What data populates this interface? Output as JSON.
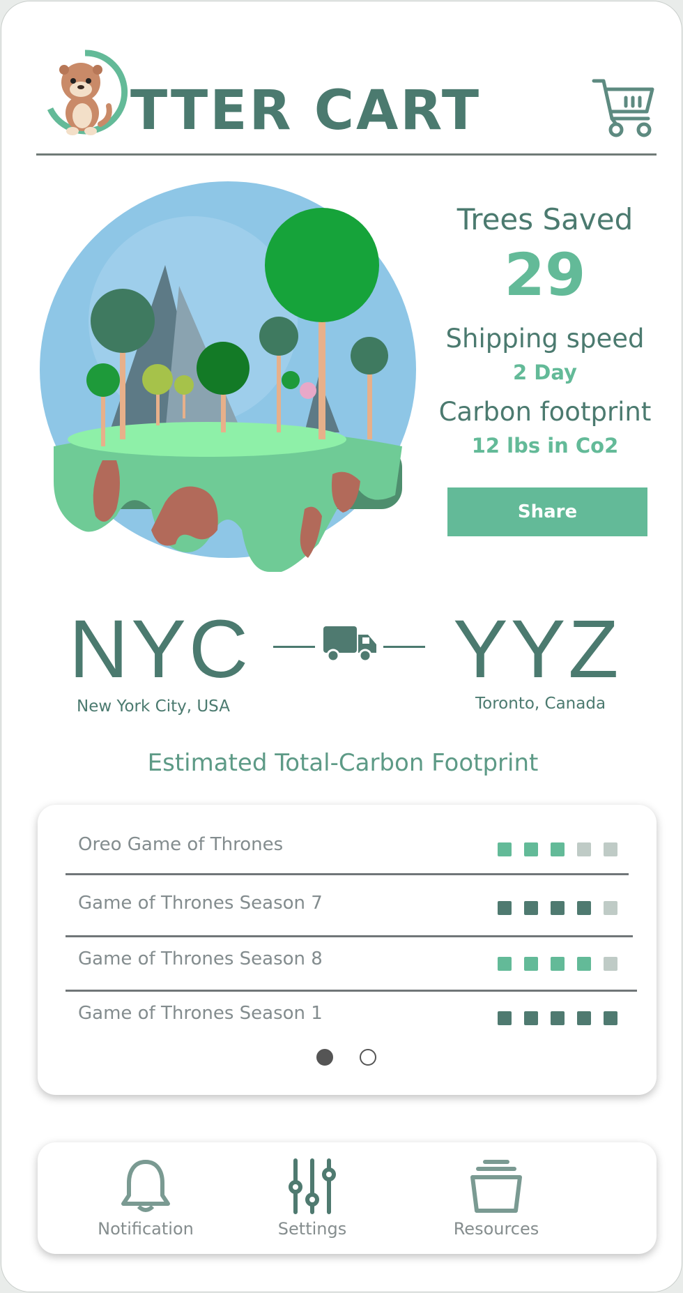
{
  "header": {
    "brand": "TTER CART",
    "logo_icon": "otter-logo-icon",
    "cart_icon": "shopping-cart-icon"
  },
  "stats": {
    "trees_label": "Trees Saved",
    "trees_value": "29",
    "shipping_label": "Shipping speed",
    "shipping_value": "2 Day",
    "carbon_label": "Carbon footprint",
    "carbon_value": "12 lbs in Co2",
    "share_label": "Share"
  },
  "route": {
    "origin_code": "NYC",
    "origin_city": "New York City, USA",
    "dest_code": "YYZ",
    "dest_city": "Toronto, Canada",
    "vehicle_icon": "truck-icon"
  },
  "footprint": {
    "title": "Estimated Total-Carbon Footprint",
    "items": [
      {
        "name": "Oreo Game of Thrones",
        "score": 3,
        "max": 5,
        "color": "#63ba98"
      },
      {
        "name": "Game of Thrones Season 7",
        "score": 4,
        "max": 5,
        "color": "#4f7a70"
      },
      {
        "name": "Game of Thrones Season 8",
        "score": 4,
        "max": 5,
        "color": "#63ba98"
      },
      {
        "name": "Game of Thrones Season 1",
        "score": 5,
        "max": 5,
        "color": "#4f7a70"
      }
    ],
    "page": 1,
    "page_count": 2
  },
  "nav": {
    "items": [
      {
        "label": "Notification",
        "icon": "bell-icon"
      },
      {
        "label": "Settings",
        "icon": "sliders-icon"
      },
      {
        "label": "Resources",
        "icon": "archive-icon"
      }
    ]
  },
  "colors": {
    "primary": "#4b7a6f",
    "accent": "#63ba98",
    "empty": "#bfcbc6"
  }
}
